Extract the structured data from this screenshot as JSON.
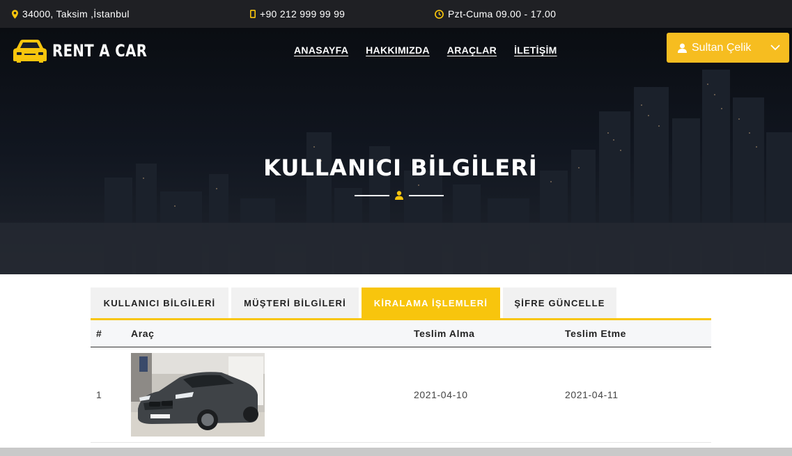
{
  "topbar": {
    "address": "34000, Taksim ,İstanbul",
    "phone": "+90 212 999 99 99",
    "hours": "Pzt-Cuma 09.00 - 17.00"
  },
  "brand": {
    "name": "RENT A CAR"
  },
  "nav": {
    "items": [
      {
        "label": "ANASAYFA"
      },
      {
        "label": "HAKKIMIZDA"
      },
      {
        "label": "ARAÇLAR"
      },
      {
        "label": "İLETİŞİM"
      }
    ]
  },
  "user": {
    "name": "Sultan Çelik"
  },
  "hero": {
    "title": "KULLANICI BİLGİLERİ"
  },
  "tabs": [
    {
      "label": "KULLANICI BİLGİLERİ",
      "active": false
    },
    {
      "label": "MÜŞTERİ BİLGİLERİ",
      "active": false
    },
    {
      "label": "KİRALAMA İŞLEMLERİ",
      "active": true
    },
    {
      "label": "ŞİFRE GÜNCELLE",
      "active": false
    }
  ],
  "table": {
    "headers": {
      "index": "#",
      "car": "Araç",
      "pickup": "Teslim Alma",
      "return": "Teslim Etme"
    },
    "rows": [
      {
        "index": "1",
        "pickup": "2021-04-10",
        "return": "2021-04-11"
      }
    ]
  },
  "colors": {
    "accent": "#f8c50d",
    "button": "#f6bd20",
    "topbar": "#1f2024"
  },
  "icons": {
    "address": "map-marker-icon",
    "phone": "mobile-phone-icon",
    "hours": "clock-icon",
    "user": "user-icon",
    "dropdown": "chevron-down-icon",
    "logo": "car-icon"
  }
}
